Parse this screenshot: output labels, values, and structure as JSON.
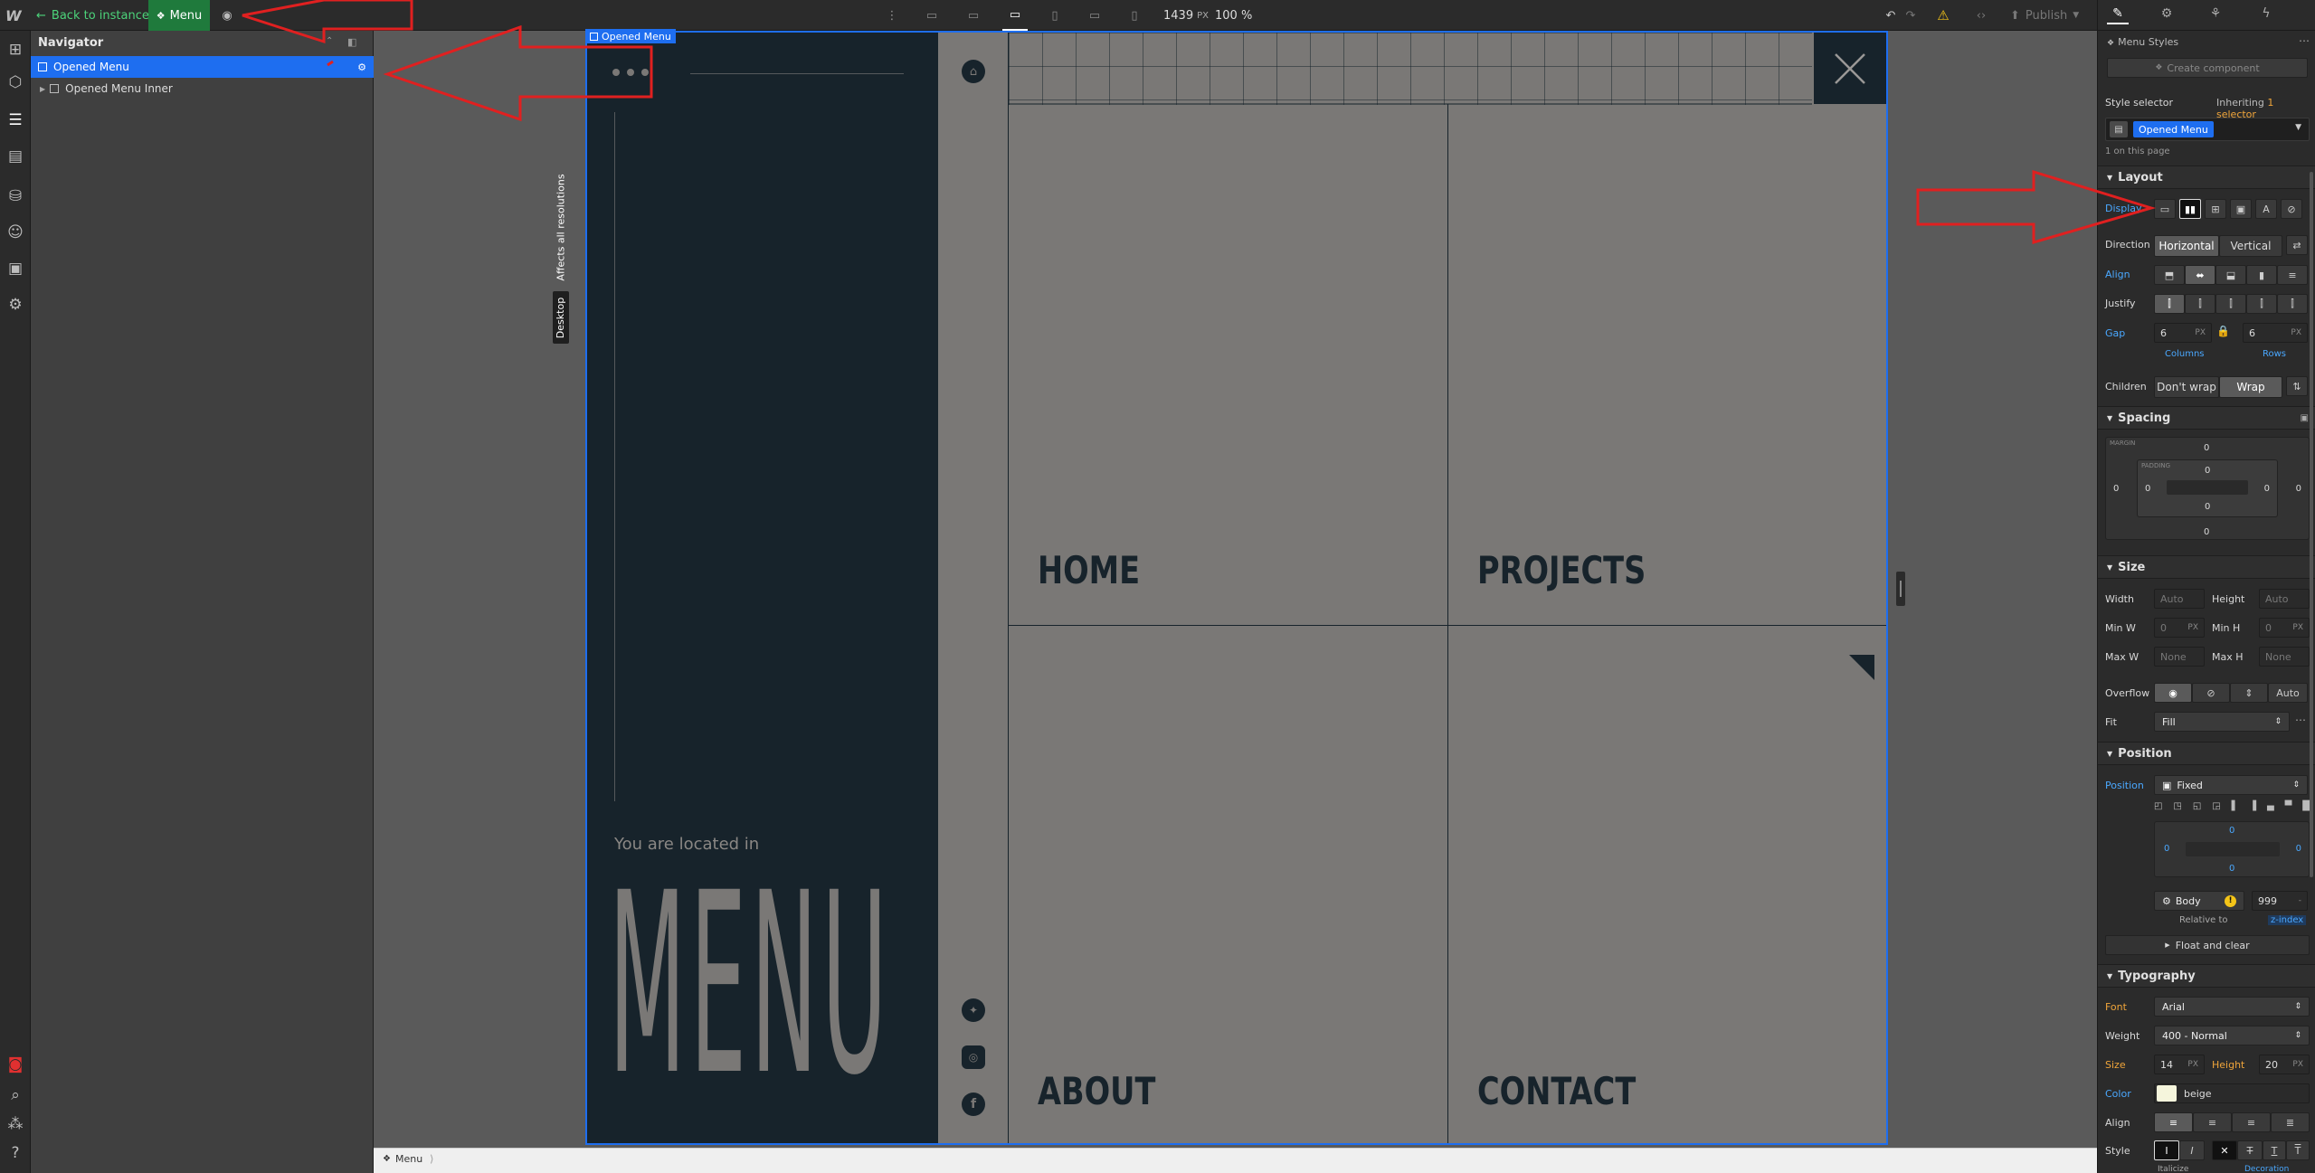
{
  "topbar": {
    "logo": "W",
    "back_label": "Back to instance",
    "component_label": "Menu",
    "width_value": "1439",
    "width_unit": "PX",
    "zoom": "100 %",
    "publish_label": "Publish"
  },
  "navigator": {
    "title": "Navigator",
    "rows": [
      {
        "label": "Opened Menu",
        "selected": true
      },
      {
        "label": "Opened Menu Inner",
        "selected": false
      }
    ]
  },
  "canvas": {
    "selected_tag": "Opened Menu",
    "side_label_affects": "Affects all resolutions",
    "side_label_desktop": "Desktop",
    "located_text": "You are located in",
    "big_word": "MENU",
    "menu_items": [
      "HOME",
      "PROJECTS",
      "ABOUT",
      "CONTACT"
    ]
  },
  "bottombar": {
    "breadcrumb": "Menu"
  },
  "right_panel": {
    "header_title": "Menu Styles",
    "create_component": "Create component",
    "style_selector_label": "Style selector",
    "inheriting_label": "Inheriting",
    "inheriting_count": "1 selector",
    "selector_tag": "Opened Menu",
    "on_page": "1 on this page",
    "layout": {
      "title": "Layout",
      "display_label": "Display",
      "direction_label": "Direction",
      "direction_options": [
        "Horizontal",
        "Vertical"
      ],
      "align_label": "Align",
      "justify_label": "Justify",
      "gap_label": "Gap",
      "gap_columns": "6",
      "gap_rows": "6",
      "gap_unit": "PX",
      "columns_label": "Columns",
      "rows_label": "Rows",
      "children_label": "Children",
      "children_options": [
        "Don't wrap",
        "Wrap"
      ]
    },
    "spacing": {
      "title": "Spacing",
      "margin_label": "MARGIN",
      "padding_label": "PADDING",
      "margin_top": "0",
      "margin_right": "0",
      "margin_bottom": "0",
      "margin_left": "0",
      "padding_top": "0",
      "padding_right": "0",
      "padding_bottom": "0",
      "padding_left": "0"
    },
    "size": {
      "title": "Size",
      "width_label": "Width",
      "width_value": "Auto",
      "height_label": "Height",
      "height_value": "Auto",
      "minw_label": "Min W",
      "minw_value": "0",
      "minh_label": "Min H",
      "minh_value": "0",
      "maxw_label": "Max W",
      "maxw_value": "None",
      "maxh_label": "Max H",
      "maxh_value": "None",
      "unit": "PX",
      "overflow_label": "Overflow",
      "overflow_auto": "Auto",
      "fit_label": "Fit",
      "fit_value": "Fill"
    },
    "position": {
      "title": "Position",
      "position_label": "Position",
      "position_value": "Fixed",
      "top": "0",
      "right": "0",
      "bottom": "0",
      "left": "0",
      "relative_target": "Body",
      "zindex_value": "999",
      "relative_to_label": "Relative to",
      "zindex_label": "z-index",
      "float_clear": "Float and clear"
    },
    "typography": {
      "title": "Typography",
      "font_label": "Font",
      "font_value": "Arial",
      "weight_label": "Weight",
      "weight_value": "400 - Normal",
      "size_label": "Size",
      "size_value": "14",
      "height_label": "Height",
      "height_value": "20",
      "unit": "PX",
      "color_label": "Color",
      "color_value": "beige",
      "align_label": "Align",
      "style_label": "Style",
      "italicize": "Italicize",
      "decoration": "Decoration"
    }
  },
  "colors": {
    "accent_blue": "#1e6ef0",
    "menu_dark": "#17232b",
    "menu_grey": "#7a7876",
    "annotation_red": "#e02020",
    "component_green": "#1f7a3c"
  }
}
